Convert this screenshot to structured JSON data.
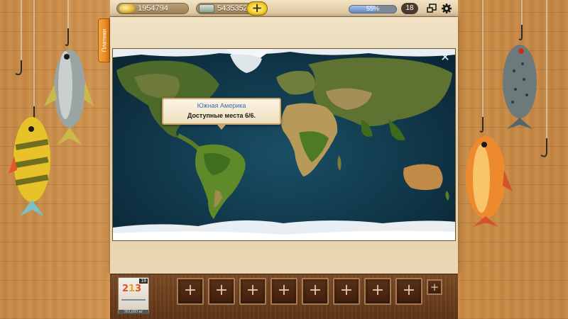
{
  "header": {
    "gold_value": "1954794",
    "money_value": "5435352",
    "add_label": "+",
    "xp_percent_label": "55%",
    "xp_fraction": 0.55,
    "level": "18"
  },
  "side_tab": {
    "label": "Платежи"
  },
  "map": {
    "close_label": "✕",
    "tooltip_region": "Южная Америка",
    "tooltip_places": "Доступные места 6/6."
  },
  "bottom": {
    "card_badge": "18",
    "card_digit_1": "2",
    "card_digit_2": "1",
    "card_digit_3": "3",
    "card_weight": "361,693 кг",
    "slot_label": "+",
    "small_slot_label": "+"
  },
  "colors": {
    "accent_blue": "#3d6fb0",
    "tab_orange": "#ee8c24",
    "coin_gold": "#e2b43a"
  }
}
